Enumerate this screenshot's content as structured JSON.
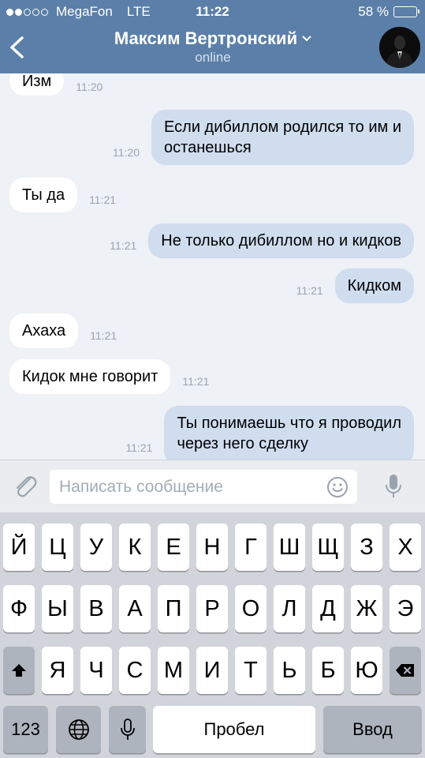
{
  "status_bar": {
    "carrier": "MegaFon",
    "network": "LTE",
    "time": "11:22",
    "battery": "58 %",
    "battery_level": 0.58
  },
  "header": {
    "contact_name": "Максим Вертронский",
    "contact_status": "online"
  },
  "messages": [
    {
      "direction": "incoming",
      "text": "Изм",
      "time": "11:20"
    },
    {
      "direction": "outgoing",
      "lines": [
        "Если дибиллом родился то им  и",
        "останешься"
      ],
      "time": "11:20"
    },
    {
      "direction": "incoming",
      "text": "Ты да",
      "time": "11:21"
    },
    {
      "direction": "outgoing",
      "text": "Не только дибиллом но и кидков",
      "time": "11:21"
    },
    {
      "direction": "outgoing",
      "text": "Кидком",
      "time": "11:21"
    },
    {
      "direction": "incoming",
      "text": "Ахаха",
      "time": "11:21"
    },
    {
      "direction": "incoming",
      "text": "Кидок мне говорит",
      "time": "11:21"
    },
    {
      "direction": "outgoing",
      "lines": [
        "Ты понимаешь что я проводил",
        "через него сделку"
      ],
      "time": "11:21"
    }
  ],
  "input": {
    "placeholder": "Написать сообщение"
  },
  "keyboard": {
    "row1": [
      "Й",
      "Ц",
      "У",
      "К",
      "Е",
      "Н",
      "Г",
      "Ш",
      "Щ",
      "З",
      "Х"
    ],
    "row2": [
      "Ф",
      "Ы",
      "В",
      "А",
      "П",
      "Р",
      "О",
      "Л",
      "Д",
      "Ж",
      "Э"
    ],
    "row3": [
      "Я",
      "Ч",
      "С",
      "М",
      "И",
      "Т",
      "Ь",
      "Б",
      "Ю"
    ],
    "numbers_key": "123",
    "space_key": "Пробел",
    "return_key": "Ввод"
  },
  "colors": {
    "header_bg": "#5b7fa8",
    "incoming_bubble": "#ffffff",
    "outgoing_bubble": "#cfddef",
    "chat_bg": "#eef1f5"
  },
  "icons": [
    "back-chevron-icon",
    "name-dropdown-chevron-icon",
    "paperclip-icon",
    "emoji-icon",
    "microphone-icon",
    "globe-icon",
    "shift-icon",
    "backspace-icon"
  ]
}
